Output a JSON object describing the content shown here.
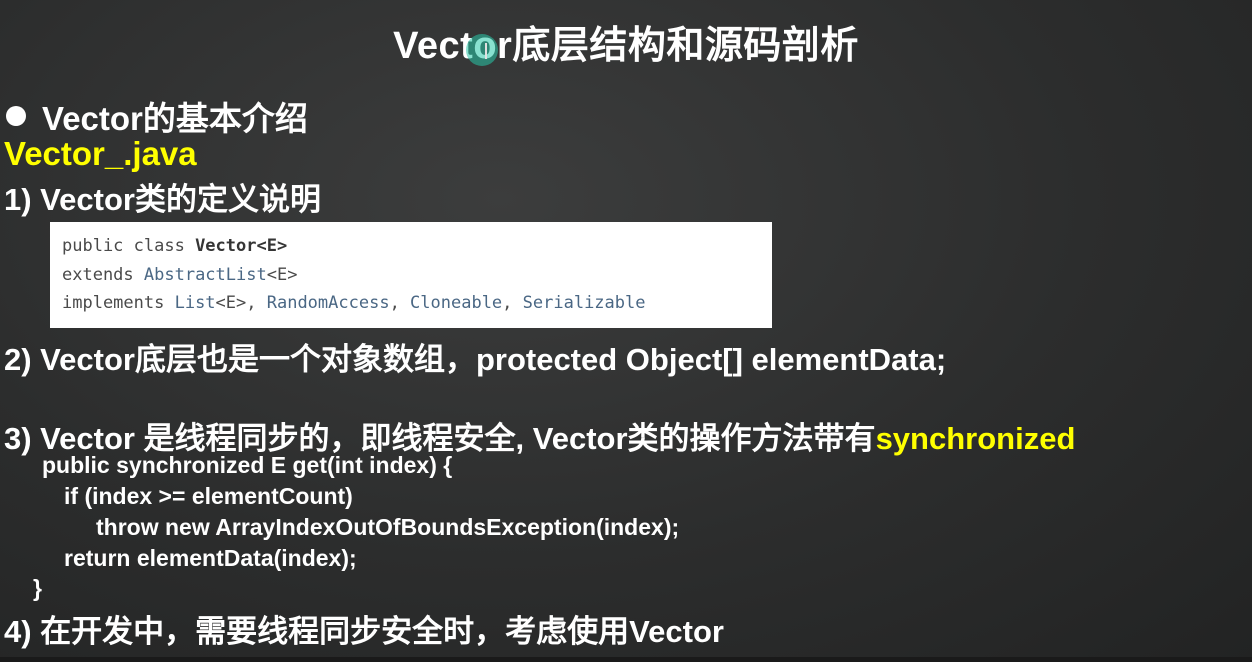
{
  "title": "Vector底层结构和源码剖析",
  "section_heading": "Vector的基本介绍",
  "file_name": "Vector_.java",
  "item1": "1) Vector类的定义说明",
  "declaration": {
    "line1_prefix": "public class ",
    "line1_name": "Vector<E>",
    "line2_prefix": "extends ",
    "line2_type": "AbstractList",
    "line2_suffix": "<E>",
    "line3_prefix": "implements ",
    "line3_t1": "List",
    "line3_s1": "<E>, ",
    "line3_t2": "RandomAccess",
    "line3_s2": ", ",
    "line3_t3": "Cloneable",
    "line3_s3": ", ",
    "line3_t4": "Serializable"
  },
  "item2": "2) Vector底层也是一个对象数组，protected Object[] elementData;",
  "item3_text": "3) Vector 是线程同步的，即线程安全, Vector类的操作方法带有",
  "item3_highlight": "synchronized",
  "code": [
    "public synchronized E get(int index) {",
    "if (index >= elementCount)",
    "throw new ArrayIndexOutOfBoundsException(index);",
    "return elementData(index);",
    "}"
  ],
  "item4": "4) 在开发中，需要线程同步安全时，考虑使用Vector",
  "colors": {
    "background": "#2c2d2d",
    "text": "#ffffff",
    "highlight": "#ffff00",
    "cursor_highlight": "#28c8aa"
  }
}
